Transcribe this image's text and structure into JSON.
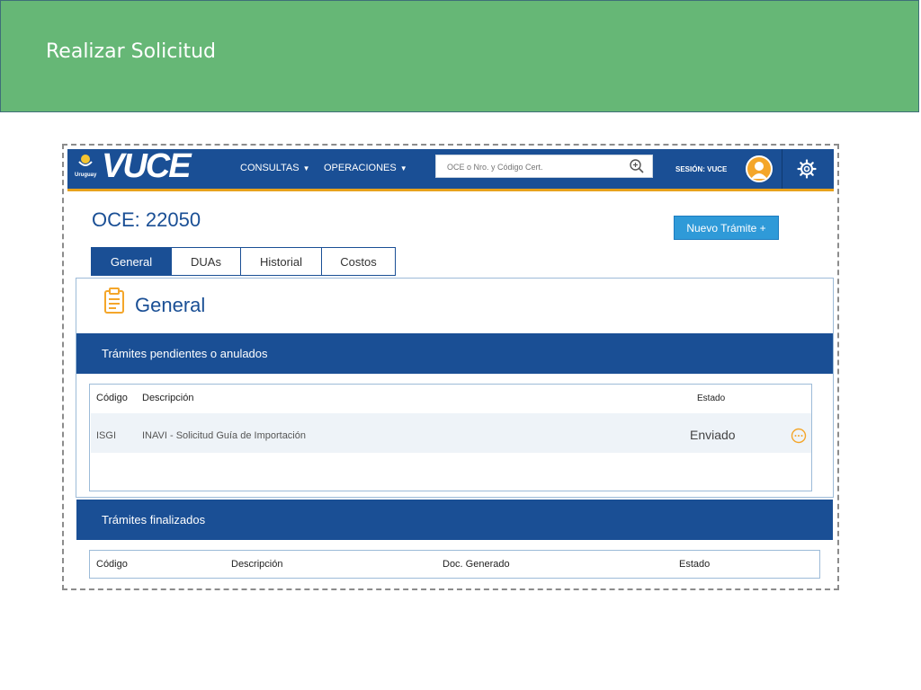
{
  "slide": {
    "title": "Realizar Solicitud"
  },
  "topbar": {
    "logo_country": "Uruguay",
    "logo_text": "VUCE",
    "nav": [
      {
        "label": "CONSULTAS",
        "icon": "chevron-down-icon"
      },
      {
        "label": "OPERACIONES",
        "icon": "chevron-down-icon"
      }
    ],
    "search_placeholder": "OCE o Nro. y Código Cert.",
    "session_label": "SESIÓN: VUCE"
  },
  "page": {
    "title": "OCE: 22050",
    "new_button": "Nuevo Trámite +",
    "tabs": [
      "General",
      "DUAs",
      "Historial",
      "Costos"
    ],
    "active_tab": "General"
  },
  "general": {
    "heading": "General",
    "pending": {
      "title": "Trámites pendientes o anulados",
      "columns": [
        "Código",
        "Descripción",
        "Estado"
      ],
      "rows": [
        {
          "codigo": "ISGI",
          "descripcion": "INAVI - Solicitud Guía de Importación",
          "estado": "Enviado"
        }
      ]
    },
    "finished": {
      "title": "Trámites finalizados",
      "columns": [
        "Código",
        "Descripción",
        "Doc. Generado",
        "Estado"
      ]
    }
  },
  "colors": {
    "banner": "#66b776",
    "primary": "#1a4f95",
    "accent": "#e8a21c",
    "button": "#2f9ad8"
  }
}
